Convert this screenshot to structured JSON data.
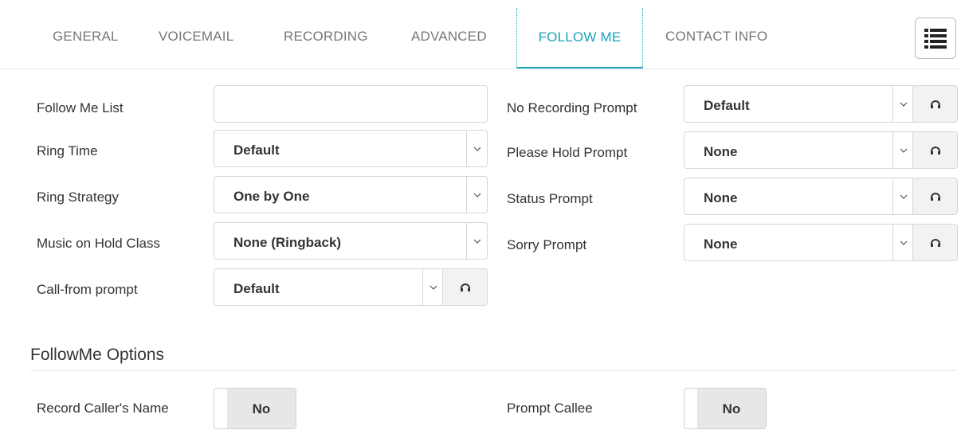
{
  "tabs": [
    {
      "label": "GENERAL",
      "active": false
    },
    {
      "label": "VOICEMAIL",
      "active": false
    },
    {
      "label": "RECORDING",
      "active": false
    },
    {
      "label": "ADVANCED",
      "active": false
    },
    {
      "label": "FOLLOW ME",
      "active": true
    },
    {
      "label": "CONTACT INFO",
      "active": false
    }
  ],
  "menu_icon": "list-menu-icon",
  "left_form": {
    "follow_me_list": {
      "label": "Follow Me List",
      "value": ""
    },
    "ring_time": {
      "label": "Ring Time",
      "value": "Default"
    },
    "ring_strategy": {
      "label": "Ring Strategy",
      "value": "One by One"
    },
    "music_on_hold": {
      "label": "Music on Hold Class",
      "value": "None (Ringback)"
    },
    "call_from_prompt": {
      "label": "Call-from prompt",
      "value": "Default"
    }
  },
  "right_form": {
    "no_recording_prompt": {
      "label": "No Recording Prompt",
      "value": "Default"
    },
    "please_hold_prompt": {
      "label": "Please Hold Prompt",
      "value": "None"
    },
    "status_prompt": {
      "label": "Status Prompt",
      "value": "None"
    },
    "sorry_prompt": {
      "label": "Sorry Prompt",
      "value": "None"
    }
  },
  "options": {
    "title": "FollowMe Options",
    "record_callers_name": {
      "label": "Record Caller's Name",
      "value": "No"
    },
    "prompt_callee": {
      "label": "Prompt Callee",
      "value": "No"
    }
  },
  "colors": {
    "accent": "#1aa3b8",
    "border": "#d6d6d6",
    "toggle_bg": "#e7e7e7"
  }
}
